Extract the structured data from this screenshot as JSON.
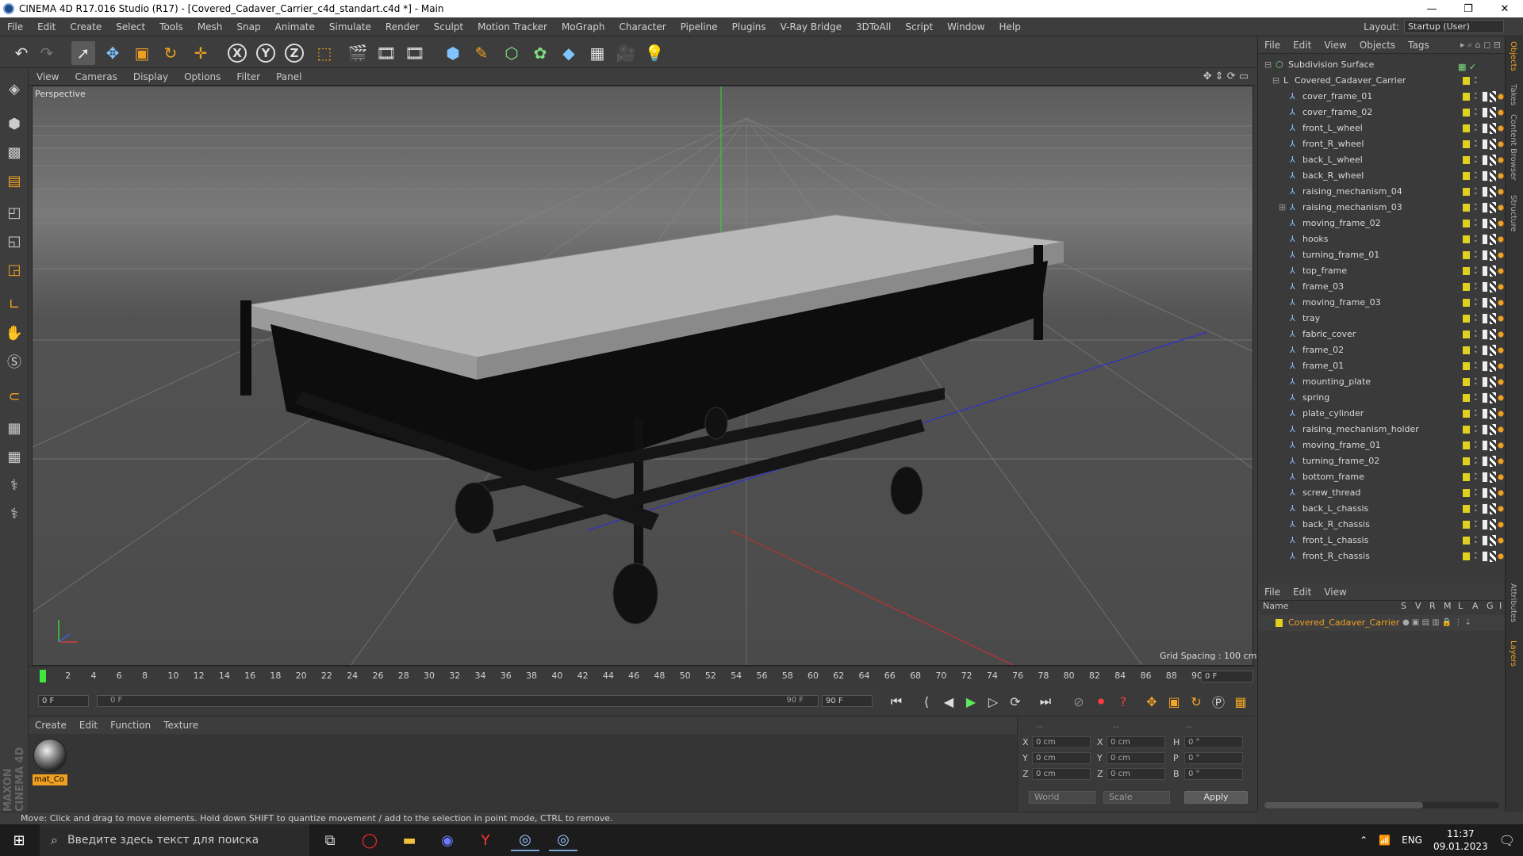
{
  "window": {
    "title": "CINEMA 4D R17.016 Studio (R17) - [Covered_Cadaver_Carrier_c4d_standart.c4d *] - Main",
    "controls": [
      "—",
      "❐",
      "✕"
    ]
  },
  "menu": [
    "File",
    "Edit",
    "Create",
    "Select",
    "Tools",
    "Mesh",
    "Snap",
    "Animate",
    "Simulate",
    "Render",
    "Sculpt",
    "Motion Tracker",
    "MoGraph",
    "Character",
    "Pipeline",
    "Plugins",
    "V-Ray Bridge",
    "3DToAll",
    "Script",
    "Window",
    "Help"
  ],
  "layout": {
    "label": "Layout:",
    "value": "Startup (User)"
  },
  "toolbar": {
    "undo": "↶",
    "redo": "↷",
    "select": "➚",
    "move": "✥",
    "scale": "▣",
    "rotate": "↻",
    "live": "✛",
    "x": "X",
    "y": "Y",
    "z": "Z",
    "coord": "⬚",
    "render1": "🎬",
    "render2": "🎞",
    "render3": "🎞",
    "cube": "⬢",
    "pen": "✎",
    "subdiv": "⬡",
    "clone": "✿",
    "deform": "◆",
    "floor": "▦",
    "camera": "🎥",
    "light": "💡"
  },
  "viewport": {
    "menu": [
      "View",
      "Cameras",
      "Display",
      "Options",
      "Filter",
      "Panel"
    ],
    "label": "Perspective",
    "grid_spacing": "Grid Spacing : 100 cm"
  },
  "timeline": {
    "ticks": [
      "0",
      "2",
      "4",
      "6",
      "8",
      "10",
      "12",
      "14",
      "16",
      "18",
      "20",
      "22",
      "24",
      "26",
      "28",
      "30",
      "32",
      "34",
      "36",
      "38",
      "40",
      "42",
      "44",
      "46",
      "48",
      "50",
      "52",
      "54",
      "56",
      "58",
      "60",
      "62",
      "64",
      "66",
      "68",
      "70",
      "72",
      "74",
      "76",
      "78",
      "80",
      "82",
      "84",
      "86",
      "88",
      "90"
    ],
    "current_frame": "0 F",
    "start": "0 F",
    "range_start": "0 F",
    "range_end": "90 F",
    "end": "90 F"
  },
  "materials": {
    "menu": [
      "Create",
      "Edit",
      "Function",
      "Texture"
    ],
    "items": [
      "mat_Co"
    ]
  },
  "coords": {
    "headers": [
      "--",
      "--",
      "--"
    ],
    "x_label": "X",
    "y_label": "Y",
    "z_label": "Z",
    "pos": [
      "0 cm",
      "0 cm",
      "0 cm"
    ],
    "size": [
      "0 cm",
      "0 cm",
      "0 cm"
    ],
    "rot_labels": [
      "H",
      "P",
      "B"
    ],
    "rot": [
      "0 °",
      "0 °",
      "0 °"
    ],
    "world": "World",
    "scale": "Scale",
    "apply": "Apply"
  },
  "status": "Move: Click and drag to move elements. Hold down SHIFT to quantize movement / add to the selection in point mode, CTRL to remove.",
  "objects": {
    "menu": [
      "File",
      "Edit",
      "View",
      "Objects",
      "Tags"
    ],
    "root": "Subdivision Surface",
    "group": "Covered_Cadaver_Carrier",
    "children": [
      "cover_frame_01",
      "cover_frame_02",
      "front_L_wheel",
      "front_R_wheel",
      "back_L_wheel",
      "back_R_wheel",
      "raising_mechanism_04",
      "raising_mechanism_03",
      "moving_frame_02",
      "hooks",
      "turning_frame_01",
      "top_frame",
      "frame_03",
      "moving_frame_03",
      "tray",
      "fabric_cover",
      "frame_02",
      "frame_01",
      "mounting_plate",
      "spring",
      "plate_cylinder",
      "raising_mechanism_holder",
      "moving_frame_01",
      "turning_frame_02",
      "bottom_frame",
      "screw_thread",
      "back_L_chassis",
      "back_R_chassis",
      "front_L_chassis",
      "front_R_chassis"
    ]
  },
  "layers": {
    "menu": [
      "File",
      "Edit",
      "View"
    ],
    "columns": [
      "Name",
      "S",
      "V",
      "R",
      "M",
      "L",
      "A",
      "G",
      "I"
    ],
    "items": [
      "Covered_Cadaver_Carrier"
    ]
  },
  "side_tabs": [
    "Objects",
    "Takes",
    "Content Browser",
    "Structure",
    "Attributes",
    "Layers"
  ],
  "taskbar": {
    "search_placeholder": "Введите здесь текст для поиска",
    "lang": "ENG",
    "time": "11:37",
    "date": "09.01.2023"
  },
  "brand": "MAXON CINEMA 4D",
  "colors": {
    "accent": "#f0a020",
    "object_icon": "#8fc0ff",
    "layer_color": "#e0d020"
  }
}
